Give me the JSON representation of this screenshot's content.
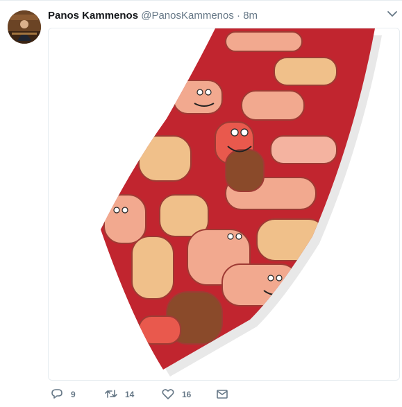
{
  "tweet": {
    "author_name": "Panos Kammenos",
    "handle": "@PanosKammenos",
    "separator": "·",
    "time": "8m"
  },
  "icons": {
    "menu": "chevron-down-icon",
    "reply": "reply-icon",
    "retweet": "retweet-icon",
    "like": "heart-icon",
    "message": "envelope-icon"
  },
  "actions": {
    "reply_count": "9",
    "retweet_count": "14",
    "like_count": "16"
  },
  "colors": {
    "text": "#14171a",
    "muted": "#657786",
    "border": "#e6ecf0",
    "tie_red": "#c1252f"
  }
}
